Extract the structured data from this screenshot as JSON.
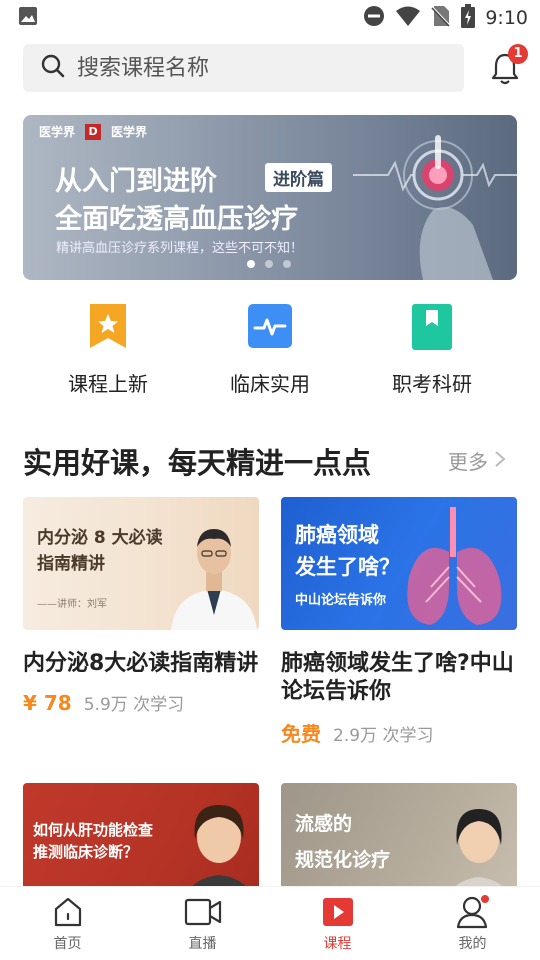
{
  "status_bar": {
    "time": "9:10"
  },
  "search": {
    "placeholder": "搜索课程名称"
  },
  "notifications": {
    "badge": "1"
  },
  "banner": {
    "logo_left": "医学界",
    "logo_right": "医学界",
    "title_line1": "从入门到进阶",
    "tag": "进阶篇",
    "title_line2": "全面吃透高血压诊疗",
    "subtitle": "精讲高血压诊疗系列课程，这些不可不知！",
    "active_slide": 1,
    "slide_count": 3
  },
  "categories": [
    {
      "label": "课程上新",
      "icon": "star-bookmark-icon",
      "color": "#f5a623"
    },
    {
      "label": "临床实用",
      "icon": "pulse-icon",
      "color": "#3d8ef5"
    },
    {
      "label": "职考科研",
      "icon": "bookmark-icon",
      "color": "#1ec7a0"
    }
  ],
  "section": {
    "title": "实用好课，每天精进一点点",
    "more": "更多"
  },
  "courses": [
    {
      "title": "内分泌8大必读指南精讲",
      "price": "¥ 78",
      "learners": "5.9万 次学习",
      "thumb_line1": "内分泌 8 大必读",
      "thumb_line2": "指南精讲",
      "thumb_line3": "——讲师：刘军"
    },
    {
      "title": "肺癌领域发生了啥?中山论坛告诉你",
      "price": "免费",
      "learners": "2.9万 次学习",
      "thumb_line1": "肺癌领域",
      "thumb_line2": "发生了啥？",
      "thumb_line3": "中山论坛告诉你"
    },
    {
      "thumb_line1": "如何从肝功能检查",
      "thumb_line2": "推测临床诊断？"
    },
    {
      "thumb_line1": "流感的",
      "thumb_line2": "规范化诊疗"
    }
  ],
  "bottom_nav": [
    {
      "label": "首页",
      "icon": "home-icon"
    },
    {
      "label": "直播",
      "icon": "video-camera-icon"
    },
    {
      "label": "课程",
      "icon": "play-course-icon",
      "active": true
    },
    {
      "label": "我的",
      "icon": "user-icon"
    }
  ],
  "colors": {
    "accent": "#e53935",
    "price": "#f5891f"
  }
}
